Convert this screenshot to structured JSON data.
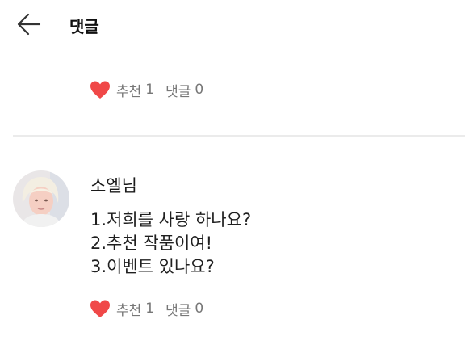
{
  "header": {
    "title": "댓글",
    "back_icon": "back-arrow-icon"
  },
  "top_actions": {
    "like_icon": "heart-icon",
    "like_color": "#f04848",
    "recommend_label": "추천",
    "recommend_count": "1",
    "comment_label": "댓글",
    "comment_count": "0"
  },
  "comment": {
    "author": "소엘님",
    "lines": [
      "1.저희를 사랑 하나요?",
      "2.추천 작품이여!",
      "3.이벤트 있나요?"
    ],
    "actions": {
      "like_icon": "heart-icon",
      "like_color": "#f04848",
      "recommend_label": "추천",
      "recommend_count": "1",
      "comment_label": "댓글",
      "comment_count": "0"
    }
  }
}
